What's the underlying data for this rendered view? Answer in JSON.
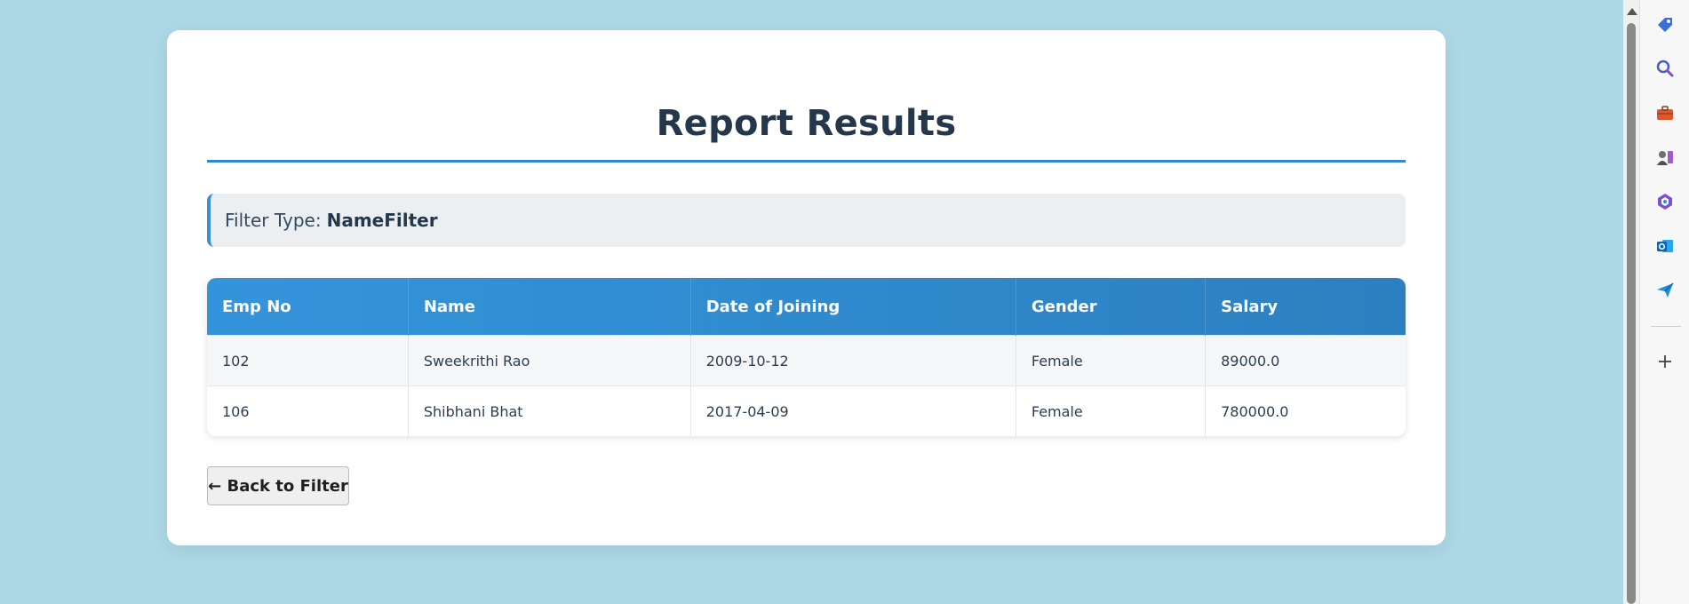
{
  "report": {
    "title": "Report Results",
    "filter_label": "Filter Type:",
    "filter_value": "NameFilter",
    "columns": [
      "Emp No",
      "Name",
      "Date of Joining",
      "Gender",
      "Salary"
    ],
    "rows": [
      [
        "102",
        "Sweekrithi Rao",
        "2009-10-12",
        "Female",
        "89000.0"
      ],
      [
        "106",
        "Shibhani Bhat",
        "2017-04-09",
        "Female",
        "780000.0"
      ]
    ],
    "back_button": "← Back to Filter"
  },
  "sidebar": {
    "icons": [
      "tag-icon",
      "search-icon",
      "briefcase-icon",
      "chess-icon",
      "copilot-icon",
      "outlook-icon",
      "send-icon"
    ],
    "add_icon": "plus-icon"
  },
  "colors": {
    "background": "#add8e6",
    "accent": "#2f89d2",
    "header_start": "#3494db",
    "header_end": "#2c80c0",
    "title": "#24374b"
  }
}
